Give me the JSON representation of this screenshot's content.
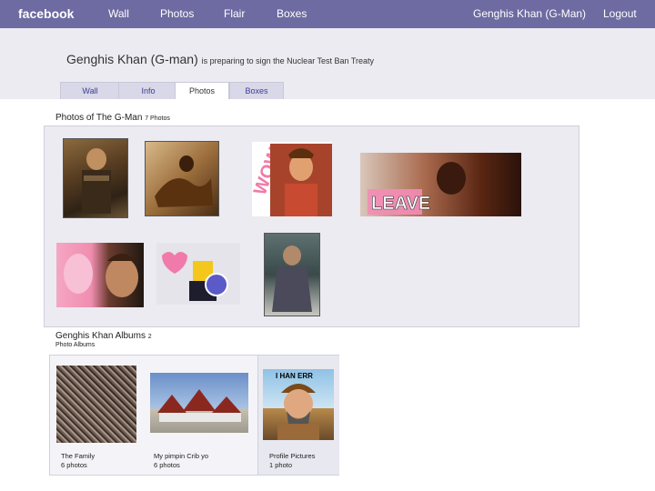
{
  "nav": {
    "logo": "facebook",
    "items": [
      "Wall",
      "Photos",
      "Flair",
      "Boxes"
    ],
    "user": "Genghis Khan (G-Man)",
    "logout": "Logout"
  },
  "profile": {
    "name": "Genghis Khan (G-man)",
    "status": "is preparing to sign the Nuclear Test Ban Treaty"
  },
  "tabs": [
    {
      "label": "Wall"
    },
    {
      "label": "Info"
    },
    {
      "label": "Photos",
      "active": true
    },
    {
      "label": "Boxes"
    }
  ],
  "photos_section": {
    "title": "Photos of The G-Man",
    "count": "7 Photos"
  },
  "photos": [
    {
      "id": "warrior-portrait"
    },
    {
      "id": "horseback-painting"
    },
    {
      "id": "wow-emperor"
    },
    {
      "id": "leave-banner"
    },
    {
      "id": "pig-collage"
    },
    {
      "id": "lego-warrior"
    },
    {
      "id": "armored-warrior"
    }
  ],
  "albums_section": {
    "title": "Genghis Khan  Albums",
    "count": "2",
    "subtitle": "Photo Albums"
  },
  "albums": [
    {
      "name": "The Family",
      "count": "6 photos"
    },
    {
      "name": "My pimpin Crib yo",
      "count": "6 photos"
    },
    {
      "name": "Profile Pictures",
      "count": "1 photo"
    }
  ],
  "colors": {
    "topbar": "#6d6ba1",
    "header": "#ebebf1",
    "link": "#3b3b98"
  }
}
